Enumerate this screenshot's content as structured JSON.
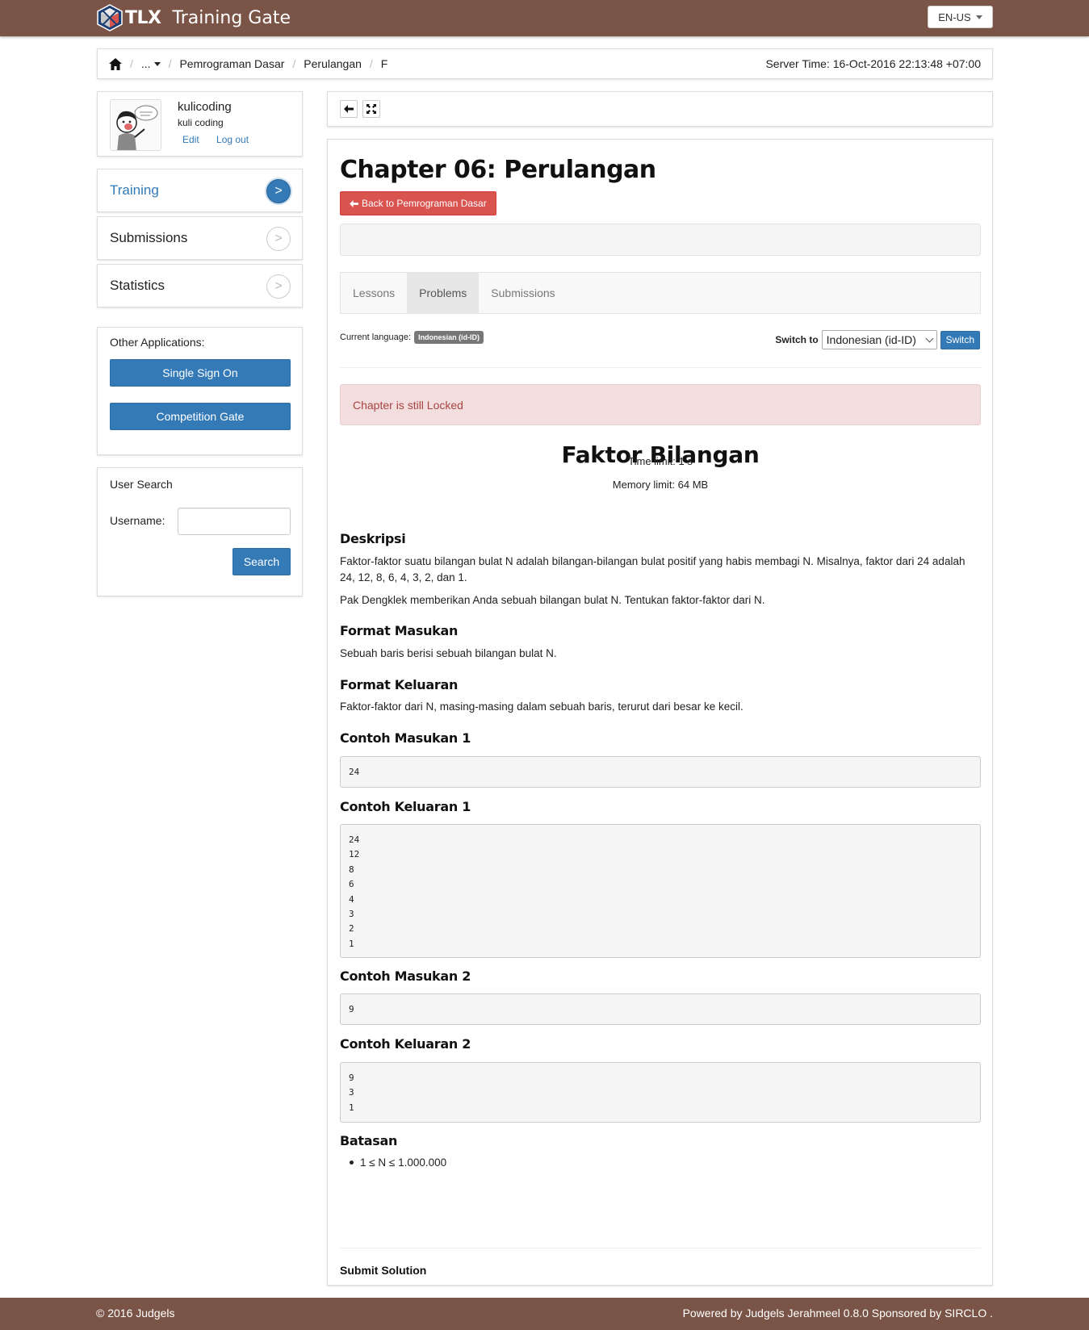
{
  "header": {
    "brand_short": "TLX",
    "brand_name": "Training Gate",
    "language_button": "EN-US"
  },
  "breadcrumb": {
    "items": [
      "...",
      "Pemrograman Dasar",
      "Perulangan",
      "F"
    ],
    "server_time": "Server Time: 16-Oct-2016 22:13:48 +07:00"
  },
  "profile": {
    "username": "kulicoding",
    "fullname": "kuli coding",
    "edit_label": "Edit",
    "logout_label": "Log out"
  },
  "sidebar": {
    "menu": [
      {
        "label": "Training",
        "active": true
      },
      {
        "label": "Submissions",
        "active": false
      },
      {
        "label": "Statistics",
        "active": false
      }
    ],
    "arrow": ">",
    "other_apps_title": "Other Applications:",
    "sso_label": "Single Sign On",
    "competition_label": "Competition Gate",
    "user_search_title": "User Search",
    "username_label": "Username:",
    "username_value": "",
    "search_label": "Search"
  },
  "main": {
    "chapter_title": "Chapter 06: Perulangan",
    "back_label": "Back to Pemrograman Dasar",
    "tabs": [
      "Lessons",
      "Problems",
      "Submissions"
    ],
    "active_tab": "Problems",
    "current_language_label": "Current language:",
    "current_language_value": "Indonesian (id-ID)",
    "switch_to_label": "Switch to",
    "switch_select_value": "Indonesian (id-ID)",
    "switch_button": "Switch",
    "alert": "Chapter is still Locked"
  },
  "problem": {
    "title": "Faktor Bilangan",
    "time_limit": "Time limit: 1 s",
    "memory_limit": "Memory limit: 64 MB",
    "deskripsi_heading": "Deskripsi",
    "deskripsi_p1": "Faktor-faktor suatu bilangan bulat N adalah bilangan-bilangan bulat positif yang habis membagi N. Misalnya, faktor dari 24 adalah 24, 12, 8, 6, 4, 3, 2, dan 1.",
    "deskripsi_p2": "Pak Dengklek memberikan Anda sebuah bilangan bulat N. Tentukan faktor-faktor dari N.",
    "format_masukan_heading": "Format Masukan",
    "format_masukan": "Sebuah baris berisi sebuah bilangan bulat N.",
    "format_keluaran_heading": "Format Keluaran",
    "format_keluaran": "Faktor-faktor dari N, masing-masing dalam sebuah baris, terurut dari besar ke kecil.",
    "contoh_masukan_1_heading": "Contoh Masukan 1",
    "contoh_masukan_1": "24",
    "contoh_keluaran_1_heading": "Contoh Keluaran 1",
    "contoh_keluaran_1": "24\n12\n8\n6\n4\n3\n2\n1",
    "contoh_masukan_2_heading": "Contoh Masukan 2",
    "contoh_masukan_2": "9",
    "contoh_keluaran_2_heading": "Contoh Keluaran 2",
    "contoh_keluaran_2": "9\n3\n1",
    "batasan_heading": "Batasan",
    "batasan_item": "1 ≤ N ≤ 1.000.000",
    "submit_heading": "Submit Solution"
  },
  "footer": {
    "left": "© 2016 Judgels",
    "right": "Powered by Judgels Jerahmeel 0.8.0 Sponsored by SIRCLO ."
  },
  "colors": {
    "navbar": "#7a5547",
    "primary": "#337ab7",
    "danger": "#d9534f",
    "alert_bg": "#f2dede",
    "alert_text": "#a94442"
  },
  "icons": {
    "brand": "tlx-logo-icon",
    "home": "home-icon",
    "back": "arrow-left-icon",
    "fullscreen": "fullscreen-icon"
  }
}
